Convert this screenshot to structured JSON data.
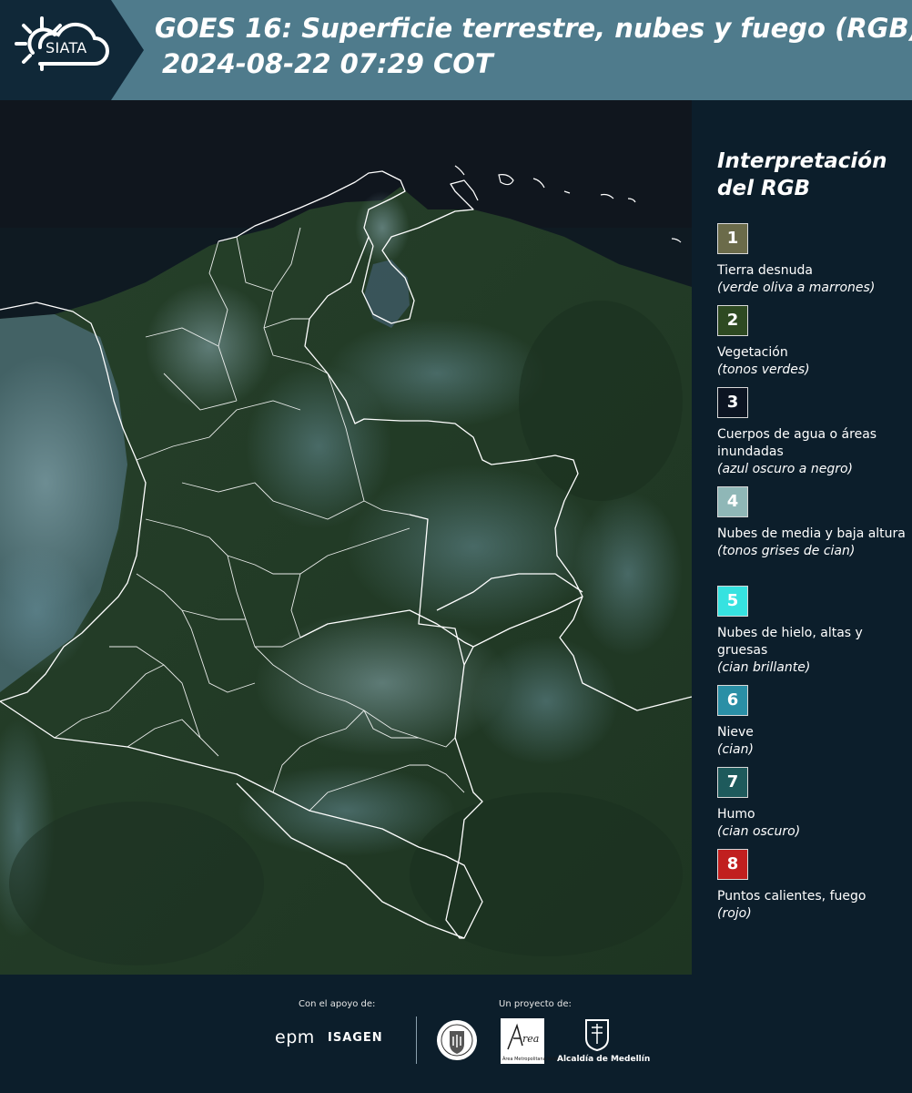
{
  "header": {
    "logo_text": "SIATA",
    "title": "GOES 16: Superficie terrestre, nubes y fuego (RGB)",
    "subtitle": "2024-08-22 07:29 COT"
  },
  "legend": {
    "title_line1": "Interpretación",
    "title_line2": "del RGB",
    "items": [
      {
        "number": "1",
        "label": "Tierra desnuda",
        "desc": "(verde oliva a marrones)",
        "color": "#6b6b4a"
      },
      {
        "number": "2",
        "label": "Vegetación",
        "desc": "(tonos verdes)",
        "color": "#2e4a22"
      },
      {
        "number": "3",
        "label": "Cuerpos de agua o áreas inundadas",
        "desc": "(azul oscuro a negro)",
        "color": "#0c1422"
      },
      {
        "number": "4",
        "label": "Nubes de media y baja altura",
        "desc": "(tonos grises de cian)",
        "color": "#8fb7b7"
      },
      {
        "number": "5",
        "label": "Nubes de hielo, altas y gruesas",
        "desc": "(cian brillante)",
        "color": "#36e2e0"
      },
      {
        "number": "6",
        "label": "Nieve",
        "desc": "(cian)",
        "color": "#2a8fa6"
      },
      {
        "number": "7",
        "label": "Humo",
        "desc": "(cian oscuro)",
        "color": "#1e5a5c"
      },
      {
        "number": "8",
        "label": "Puntos calientes, fuego",
        "desc": "(rojo)",
        "color": "#c11f1f"
      }
    ]
  },
  "footer": {
    "support_label": "Con el apoyo de:",
    "project_label": "Un proyecto de:",
    "sponsor1": "epm",
    "sponsor2": "ISAGEN",
    "partner1": "Área Metropolitana Valle de Aburrá",
    "partner2": "Alcaldía de Medellín"
  }
}
